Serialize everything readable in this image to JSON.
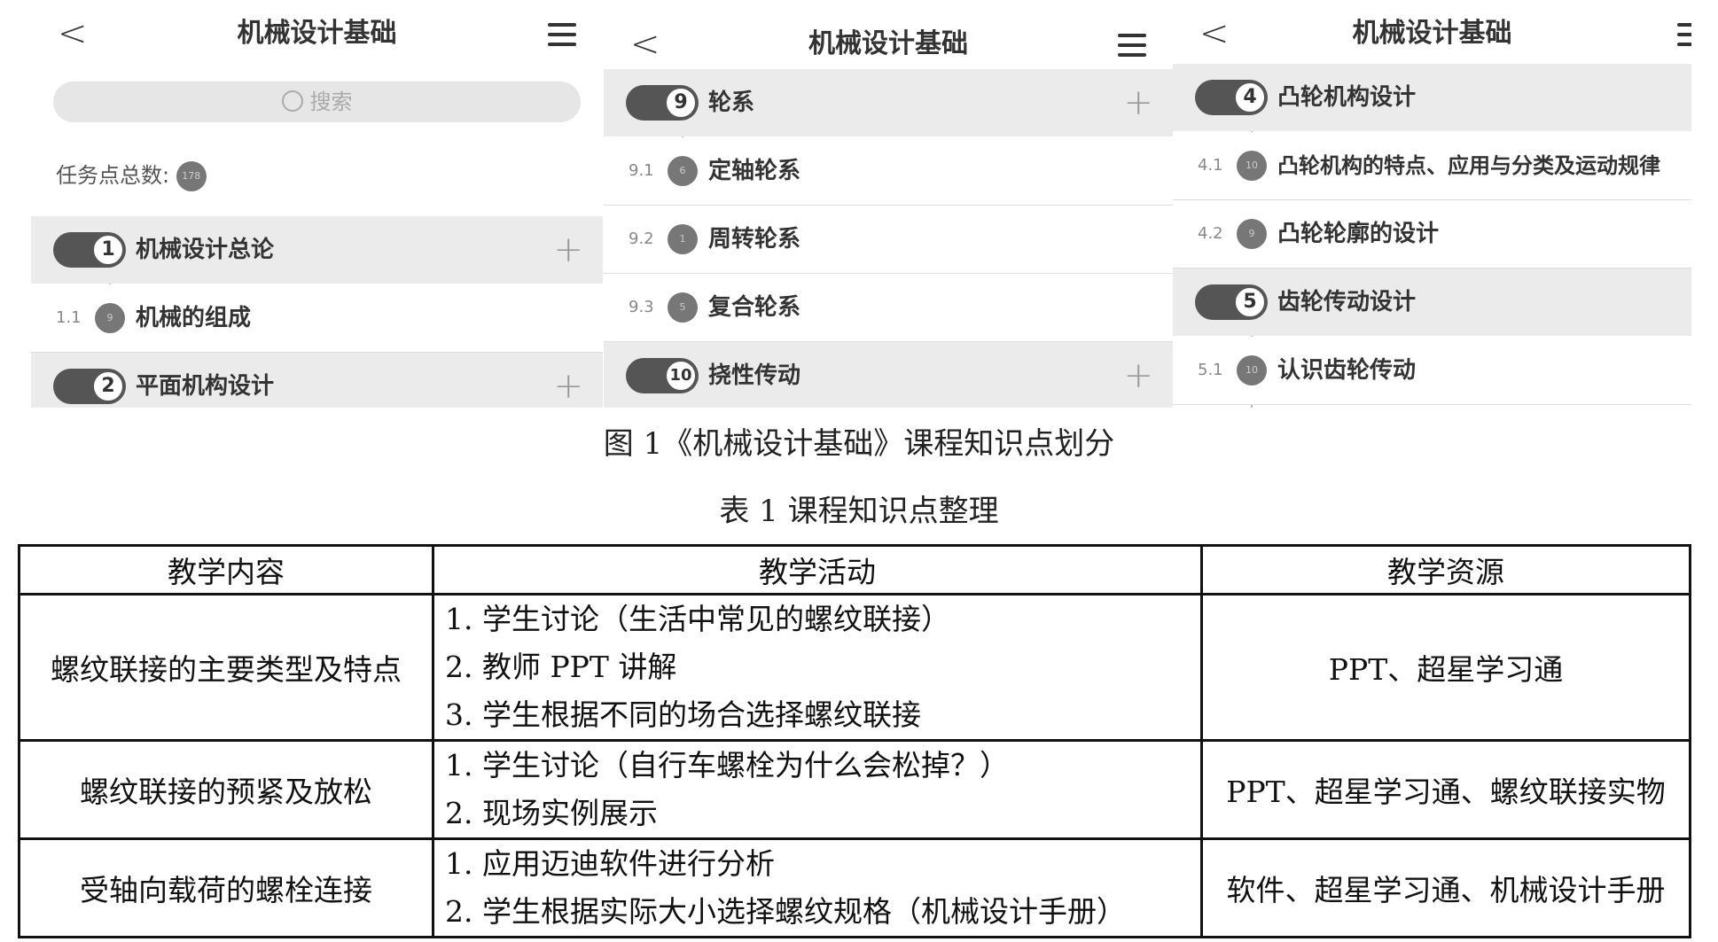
{
  "app_title": "机械设计基础",
  "search_placeholder": "搜索",
  "total_label": "任务点总数:",
  "total_count": "178",
  "panel1": {
    "chapters": [
      {
        "num": "1",
        "label": "机械设计总论"
      },
      {
        "num": "2",
        "label": "平面机构设计"
      }
    ],
    "subs": [
      {
        "num": "1.1",
        "badge": "9",
        "label": "机械的组成"
      }
    ]
  },
  "panel2": {
    "chapters": [
      {
        "num": "9",
        "label": "轮系"
      },
      {
        "num": "10",
        "label": "挠性传动"
      }
    ],
    "subs": [
      {
        "num": "9.1",
        "badge": "6",
        "label": "定轴轮系"
      },
      {
        "num": "9.2",
        "badge": "1",
        "label": "周转轮系"
      },
      {
        "num": "9.3",
        "badge": "5",
        "label": "复合轮系"
      }
    ]
  },
  "panel3": {
    "chapters": [
      {
        "num": "4",
        "label": "凸轮机构设计"
      },
      {
        "num": "5",
        "label": "齿轮传动设计"
      }
    ],
    "subs": [
      {
        "num": "4.1",
        "badge": "10",
        "label": "凸轮机构的特点、应用与分类及运动规律"
      },
      {
        "num": "4.2",
        "badge": "9",
        "label": "凸轮轮廓的设计"
      },
      {
        "num": "5.1",
        "badge": "10",
        "label": "认识齿轮传动"
      }
    ]
  },
  "figure_caption": "图 1《机械设计基础》课程知识点划分",
  "table_caption": "表 1  课程知识点整理",
  "table": {
    "headers": [
      "教学内容",
      "教学活动",
      "教学资源"
    ],
    "rows": [
      {
        "content": "螺纹联接的主要类型及特点",
        "activities": [
          "1. 学生讨论（生活中常见的螺纹联接）",
          "2. 教师 PPT 讲解",
          "3. 学生根据不同的场合选择螺纹联接"
        ],
        "resources": "PPT、超星学习通"
      },
      {
        "content": "螺纹联接的预紧及放松",
        "activities": [
          "1. 学生讨论（自行车螺栓为什么会松掉？）",
          "2. 现场实例展示"
        ],
        "resources": "PPT、超星学习通、螺纹联接实物"
      },
      {
        "content": "受轴向载荷的螺栓连接",
        "activities": [
          "1. 应用迈迪软件进行分析",
          "2. 学生根据实际大小选择螺纹规格（机械设计手册）"
        ],
        "resources": "软件、超星学习通、机械设计手册"
      }
    ]
  }
}
